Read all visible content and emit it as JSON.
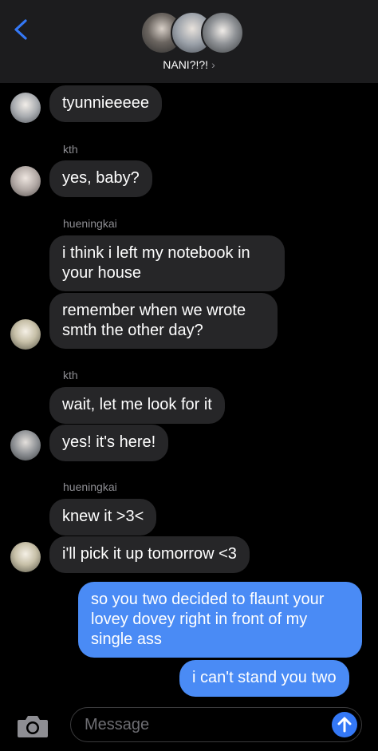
{
  "header": {
    "group_name": "NANI?!?!",
    "chevron": "›",
    "back_icon": "chevron-left-icon",
    "accent_color": "#3478f6"
  },
  "messages": [
    {
      "sender": "",
      "text": "tyunnieeeee",
      "direction": "incoming"
    },
    {
      "sender": "kth",
      "text": "yes, baby?",
      "direction": "incoming"
    },
    {
      "sender": "hueningkai",
      "text": "i think i left my notebook in your house",
      "direction": "incoming"
    },
    {
      "sender": "",
      "text": "remember when we wrote smth the other day?",
      "direction": "incoming"
    },
    {
      "sender": "kth",
      "text": "wait, let me look for it",
      "direction": "incoming"
    },
    {
      "sender": "",
      "text": "yes! it's here!",
      "direction": "incoming"
    },
    {
      "sender": "hueningkai",
      "text": "knew it >3<",
      "direction": "incoming"
    },
    {
      "sender": "",
      "text": "i'll pick it up tomorrow <3",
      "direction": "incoming"
    },
    {
      "sender": "",
      "text": "so you two decided to flaunt your lovey dovey right in front of my single ass",
      "direction": "outgoing"
    },
    {
      "sender": "",
      "text": "i can't stand you two",
      "direction": "outgoing"
    }
  ],
  "compose": {
    "placeholder": "Message",
    "camera_icon": "camera-icon",
    "send_icon": "arrow-up-icon"
  }
}
